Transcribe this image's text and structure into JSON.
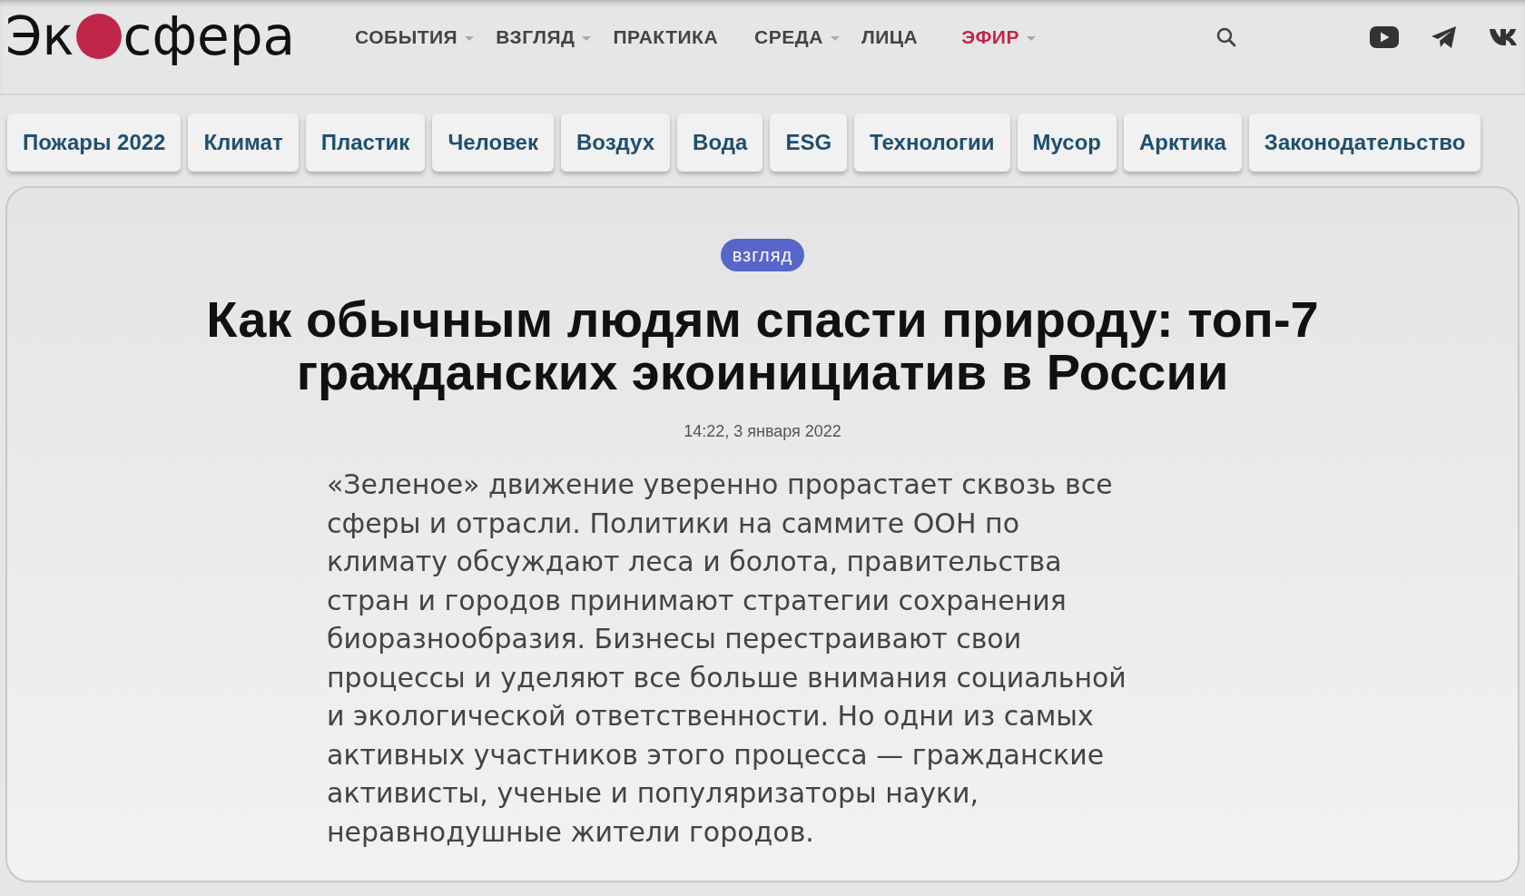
{
  "logo": {
    "before": "Эк",
    "after": "сфера"
  },
  "nav": [
    {
      "label": "СОБЫТИЯ",
      "has_dropdown": true,
      "selected": false
    },
    {
      "label": "ВЗГЛЯД",
      "has_dropdown": true,
      "selected": false
    },
    {
      "label": "ПРАКТИКА",
      "has_dropdown": false,
      "selected": false
    },
    {
      "label": "СРЕДА",
      "has_dropdown": true,
      "selected": false
    },
    {
      "label": "ЛИЦА",
      "has_dropdown": false,
      "selected": false
    },
    {
      "label": "ЭФИР",
      "has_dropdown": true,
      "selected": true
    }
  ],
  "social": [
    {
      "kind": "youtube"
    },
    {
      "kind": "telegram"
    },
    {
      "kind": "vk"
    }
  ],
  "tags": [
    "Пожары 2022",
    "Климат",
    "Пластик",
    "Человек",
    "Воздух",
    "Вода",
    "ESG",
    "Технологии",
    "Мусор",
    "Арктика",
    "Законодательство"
  ],
  "article": {
    "category": "взгляд",
    "title": "Как обычным людям спасти природу: топ-7 гражданских экоинициатив в России",
    "date": "14:22, 3 января 2022",
    "lead": "«Зеленое» движение уверенно прорастает сквозь все сферы и отрасли. Политики на саммите ООН по климату обсуждают леса и болота, правительства стран и городов принимают стратегии сохранения биоразнообразия. Бизнесы перестраивают свои процессы и уделяют все больше внимания социальной и экологической ответственности. Но одни из самых активных участников этого процесса — гражданские активисты, ученые и популяризаторы науки, неравнодушные жители городов."
  }
}
